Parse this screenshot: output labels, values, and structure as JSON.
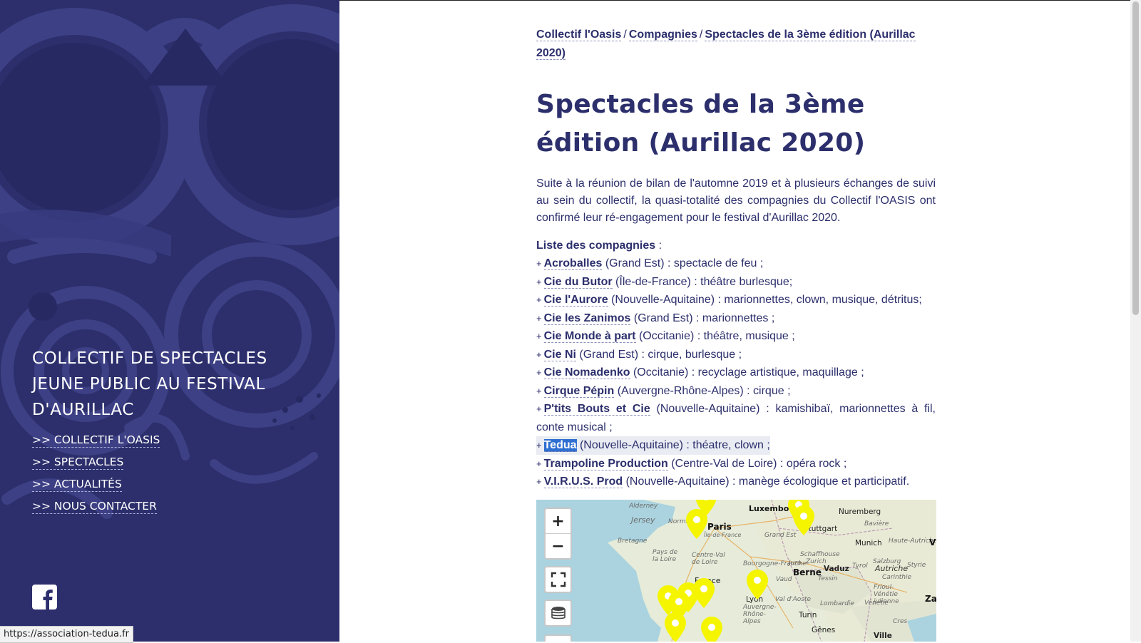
{
  "sidebar": {
    "site_title": "COLLECTIF DE SPECTACLES JEUNE PUBLIC AU FESTIVAL D'AURILLAC",
    "nav": [
      ">> COLLECTIF L'OASIS",
      ">> SPECTACLES",
      ">> ACTUALITÉS",
      ">> NOUS CONTACTER"
    ],
    "social_icon": "facebook-icon"
  },
  "status_bar_url": "https://association-tedua.fr",
  "breadcrumb": {
    "items": [
      "Collectif l'Oasis",
      "Compagnies",
      "Spectacles de la 3ème édition (Aurillac 2020)"
    ],
    "separator": "/"
  },
  "page_title": "Spectacles de la 3ème édition (Aurillac 2020)",
  "intro": "Suite à la réunion de bilan de l'automne 2019 et à plusieurs échanges de suivi au sein du collectif, la quasi-totalité des compagnies du Collectif l'OASIS ont confirmé leur ré-engagement pour le festival d'Aurillac 2020.",
  "list_heading": "Liste des compagnies",
  "list_heading_suffix": " :",
  "bullet": "+",
  "companies": [
    {
      "name": "Acroballes",
      "desc": " (Grand Est) : spectacle de feu ;"
    },
    {
      "name": "Cie du Butor",
      "desc": " (Île-de-France) : théâtre burlesque;"
    },
    {
      "name": "Cie l'Aurore",
      "desc": " (Nouvelle-Aquitaine) : marionnettes, clown, musique, détritus;"
    },
    {
      "name": "Cie les Zanimos",
      "desc": " (Grand Est) : marionnettes ;"
    },
    {
      "name": "Cie Monde à part",
      "desc": " (Occitanie) : théâtre, musique ;"
    },
    {
      "name": "Cie Ni",
      "desc": " (Grand Est) : cirque, burlesque ;"
    },
    {
      "name": "Cie Nomadenko",
      "desc": " (Occitanie) : recyclage artistique, maquillage ;"
    },
    {
      "name": "Cirque Pépin",
      "desc": " (Auvergne-Rhône-Alpes) : cirque ;"
    },
    {
      "name": "P'tits Bouts et Cie",
      "desc": " (Nouvelle-Aquitaine) : kamishibaï, marionnettes à fil, conte musical ;"
    },
    {
      "name": "Tedua",
      "desc": " (Nouvelle-Aquitaine) : théatre, clown ;"
    },
    {
      "name": "Trampoline Production",
      "desc": " (Centre-Val de Loire) : opéra rock ;"
    },
    {
      "name": "V.I.R.U.S. Prod",
      "desc": " (Nouvelle-Aquitaine) : manège écologique et participatif."
    }
  ],
  "map": {
    "controls": {
      "zoom_in": "+",
      "zoom_out": "−",
      "fullscreen_icon": "fullscreen-icon",
      "layers_icon": "layers-icon"
    },
    "pin_color": "#f5f500",
    "labels": {
      "alderney": "Alderney",
      "jersey": "Jersey",
      "normandie": "Norman",
      "paris": "Paris",
      "ile_de_france": "Île-de-France",
      "luxembourg": "Luxembo",
      "nuremberg": "Nuremberg",
      "stuttgart": "Stuttgart",
      "baviere": "Bavière",
      "bretagne": "Bretagne",
      "grand_est": "Grand Est",
      "munich": "Munich",
      "haute_autriche": "Haute-Autriche",
      "v": "V",
      "pays_de_la_loire": "Pays de la Loire",
      "centre_val_de_loire": "Centre-Val de Loire",
      "schaffhouse": "Schaffhouse",
      "zurich": "Zurich",
      "salzburg": "Salzburg",
      "tyrol": "Tyrol",
      "autriche": "Autriche",
      "styrie": "Styrie",
      "bourgogne": "Bourgogne-Franche-",
      "jura": "Jura",
      "vaduz": "Vaduz",
      "berne": "Berne",
      "carinthie": "Carinthie",
      "vaud": "Vaud",
      "tessin": "Tessin",
      "frioul": "Frioul-Vénétie julienne",
      "lyon": "Lyon",
      "val_daoste": "Val d'Aoste",
      "lombardie": "Lombardie",
      "venetie": "Vénétie",
      "zag": "Zag",
      "auvergne": "Auvergne-Rhône-Alpes",
      "turin": "Turin",
      "cres": "Cres",
      "france": "France",
      "genes": "Gênes",
      "ville": "Ville"
    }
  },
  "colors": {
    "sidebar_bg": "#2c2f6c",
    "text_primary": "#2c2f6c",
    "selection": "#2f6fd1",
    "highlight_bg": "#e9ecf2"
  }
}
